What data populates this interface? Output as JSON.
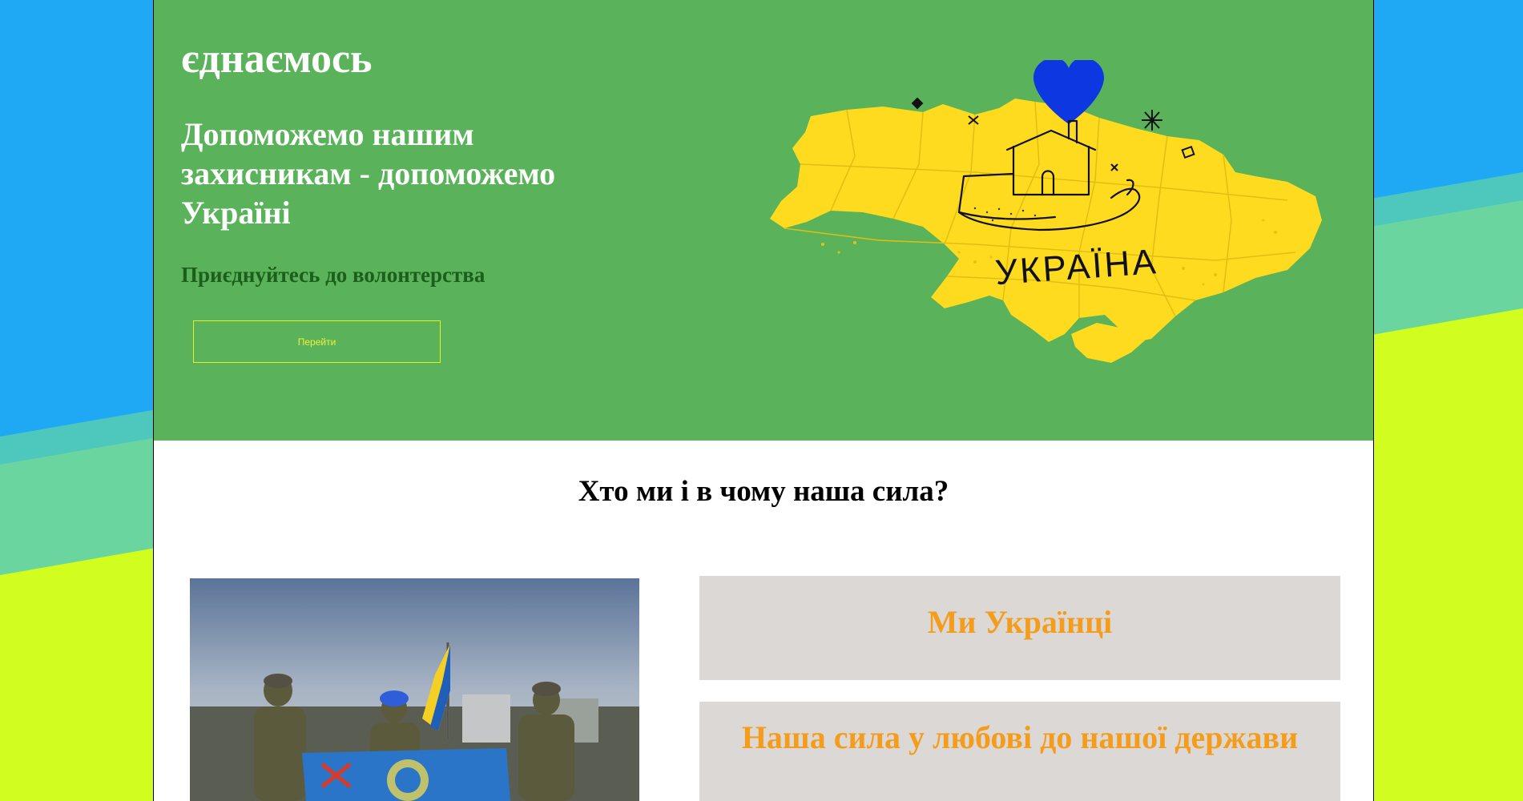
{
  "hero": {
    "brand": "єднаємось",
    "headline": "Допоможемо нашим захисникам - допоможемо Україні",
    "subline": "Приєднуйтесь до волонтерства",
    "cta_label": "Перейти",
    "map_label": "УКРАЇНА"
  },
  "about": {
    "title": "Хто ми і в чому наша сила?",
    "cards": [
      {
        "title": "Ми Українці"
      },
      {
        "title": "Наша сила у любові до нашої держави"
      }
    ]
  },
  "colors": {
    "hero_bg": "#5ab35a",
    "map_yellow": "#fedb1f",
    "heart_blue": "#0d37e0",
    "card_bg": "#dcd8d6",
    "card_text": "#f49d1c",
    "bg_blue": "#1fa9f5",
    "bg_lime": "#d1fe1f"
  },
  "icons": [
    "heart-icon",
    "house-in-hand-icon",
    "ukraine-map-illustration"
  ]
}
